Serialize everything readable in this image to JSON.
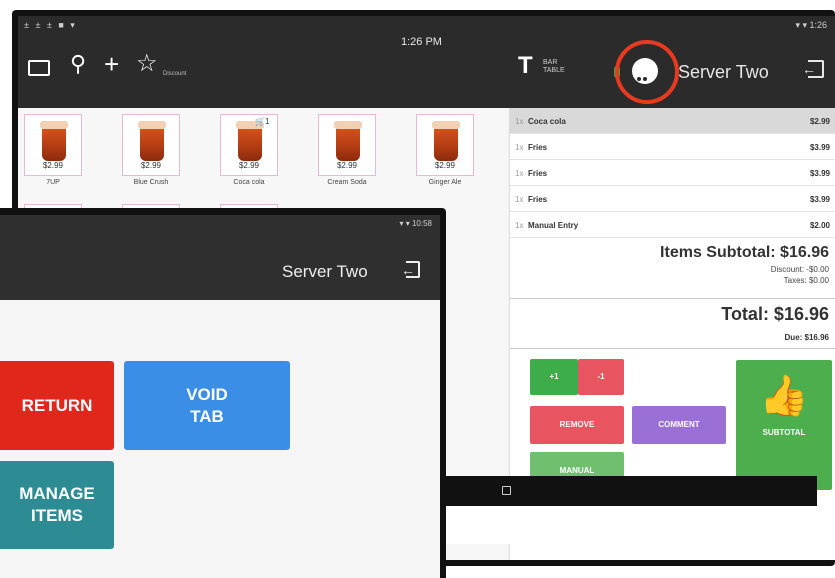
{
  "back": {
    "status_time": "1:26 PM",
    "status_left": "± ± ± ■ ▾",
    "status_right": "▾ ▾ 1:26",
    "toolbar": {
      "discount_label": "Discount",
      "bar_table_label": "BAR\nTABLE",
      "server_name": "Server Two"
    },
    "items": [
      {
        "price": "$2.99",
        "name": "7UP"
      },
      {
        "price": "$2.99",
        "name": "Blue Crush"
      },
      {
        "price": "$2.99",
        "name": "Coca cola",
        "badge": "1"
      },
      {
        "price": "$2.99",
        "name": "Cream Soda"
      },
      {
        "price": "$2.99",
        "name": "Ginger Ale"
      }
    ],
    "order_lines": [
      {
        "qty": "1x",
        "name": "Coca cola",
        "price": "$2.99",
        "selected": true
      },
      {
        "qty": "1x",
        "name": "Fries",
        "price": "$3.99"
      },
      {
        "qty": "1x",
        "name": "Fries",
        "price": "$3.99"
      },
      {
        "qty": "1x",
        "name": "Fries",
        "price": "$3.99"
      },
      {
        "qty": "1x",
        "name": "Manual Entry",
        "price": "$2.00"
      }
    ],
    "items_subtotal": "Items Subtotal: $16.96",
    "discount": "Discount: -$0.00",
    "taxes": "Taxes: $0.00",
    "total": "Total: $16.96",
    "due": "Due: $16.96",
    "actions": {
      "plus_one": "+1",
      "minus_one": "-1",
      "remove": "REMOVE",
      "comment": "COMMENT",
      "subtotal": "SUBTOTAL",
      "manual": "MANUAL"
    }
  },
  "front": {
    "status_right": "▾ ▾ 10:58",
    "server_name": "Server Two",
    "buttons": {
      "return": "RETURN",
      "void_tab": "VOID\nTAB",
      "manage_items": "MANAGE\nITEMS"
    }
  },
  "colors": {
    "highlight_ring": "#e83a1f",
    "return_red": "#e1261c",
    "void_blue": "#3a8ee6",
    "manage_teal": "#2d8b93",
    "remove_red": "#e8545f",
    "comment_purple": "#9a6fd6",
    "subtotal_green": "#4cae4c",
    "manual_green": "#6fbf6f"
  }
}
